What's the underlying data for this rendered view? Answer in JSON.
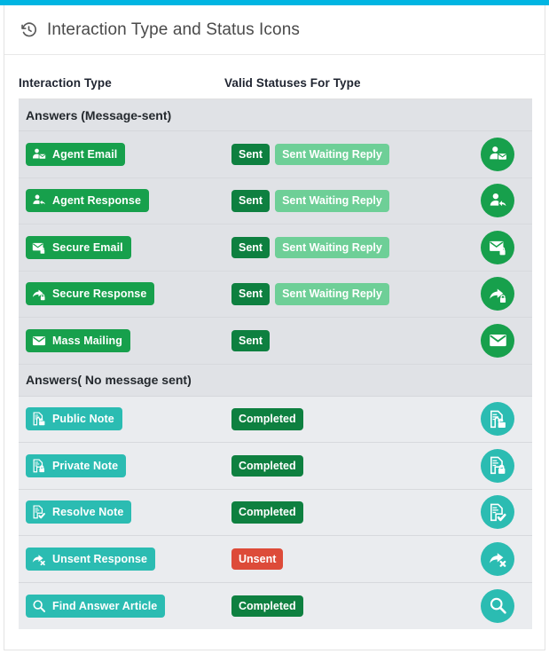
{
  "theme": {
    "accent_bar_color": "#00b5e2",
    "green": "#17a04c",
    "green_dark": "#0e8040",
    "green_light": "#6ecf97",
    "teal": "#2bbcb2",
    "red": "#dd4b39",
    "row_shade_a": "#e0e2e6",
    "row_shade_b": "#eaecef",
    "group_head_bg": "#e0e2e6"
  },
  "header": {
    "icon": "history-rewind-icon",
    "title": "Interaction Type and Status Icons"
  },
  "table": {
    "columns": [
      {
        "label": "Interaction Type"
      },
      {
        "label": "Valid Statuses For Type"
      },
      {
        "label": ""
      }
    ],
    "groups": [
      {
        "title": "Answers (Message-sent)",
        "shade": "shade-a",
        "rows": [
          {
            "type_label": "Agent Email",
            "type_color": "#17a04c",
            "type_icon": "user-envelope-icon",
            "round_color": "#17a04c",
            "round_icon": "user-envelope-icon",
            "statuses": [
              {
                "label": "Sent",
                "color": "#0e8040"
              },
              {
                "label": "Sent Waiting Reply",
                "color": "#6ecf97"
              }
            ]
          },
          {
            "type_label": "Agent Response",
            "type_color": "#17a04c",
            "type_icon": "user-reply-icon",
            "round_color": "#17a04c",
            "round_icon": "user-reply-icon",
            "statuses": [
              {
                "label": "Sent",
                "color": "#0e8040"
              },
              {
                "label": "Sent Waiting Reply",
                "color": "#6ecf97"
              }
            ]
          },
          {
            "type_label": "Secure Email",
            "type_color": "#17a04c",
            "type_icon": "envelope-lock-icon",
            "round_color": "#17a04c",
            "round_icon": "envelope-lock-icon",
            "statuses": [
              {
                "label": "Sent",
                "color": "#0e8040"
              },
              {
                "label": "Sent Waiting Reply",
                "color": "#6ecf97"
              }
            ]
          },
          {
            "type_label": "Secure Response",
            "type_color": "#17a04c",
            "type_icon": "reply-lock-icon",
            "round_color": "#17a04c",
            "round_icon": "reply-lock-icon",
            "statuses": [
              {
                "label": "Sent",
                "color": "#0e8040"
              },
              {
                "label": "Sent Waiting Reply",
                "color": "#6ecf97"
              }
            ]
          },
          {
            "type_label": "Mass Mailing",
            "type_color": "#17a04c",
            "type_icon": "envelope-icon",
            "round_color": "#17a04c",
            "round_icon": "envelope-icon",
            "statuses": [
              {
                "label": "Sent",
                "color": "#0e8040"
              }
            ]
          }
        ]
      },
      {
        "title": "Answers( No message sent)",
        "shade": "shade-b",
        "rows": [
          {
            "type_label": "Public Note",
            "type_color": "#2bbcb2",
            "type_icon": "document-unlock-icon",
            "round_color": "#2bbcb2",
            "round_icon": "document-unlock-icon",
            "statuses": [
              {
                "label": "Completed",
                "color": "#0e8040"
              }
            ]
          },
          {
            "type_label": "Private Note",
            "type_color": "#2bbcb2",
            "type_icon": "document-lock-icon",
            "round_color": "#2bbcb2",
            "round_icon": "document-lock-icon",
            "statuses": [
              {
                "label": "Completed",
                "color": "#0e8040"
              }
            ]
          },
          {
            "type_label": "Resolve Note",
            "type_color": "#2bbcb2",
            "type_icon": "document-check-icon",
            "round_color": "#2bbcb2",
            "round_icon": "document-check-icon",
            "statuses": [
              {
                "label": "Completed",
                "color": "#0e8040"
              }
            ]
          },
          {
            "type_label": "Unsent Response",
            "type_color": "#2bbcb2",
            "type_icon": "reply-x-icon",
            "round_color": "#2bbcb2",
            "round_icon": "reply-x-icon",
            "statuses": [
              {
                "label": "Unsent",
                "color": "#dd4b39"
              }
            ]
          },
          {
            "type_label": "Find Answer Article",
            "type_color": "#2bbcb2",
            "type_icon": "search-icon",
            "round_color": "#2bbcb2",
            "round_icon": "search-icon",
            "statuses": [
              {
                "label": "Completed",
                "color": "#0e8040"
              }
            ]
          }
        ]
      }
    ]
  }
}
